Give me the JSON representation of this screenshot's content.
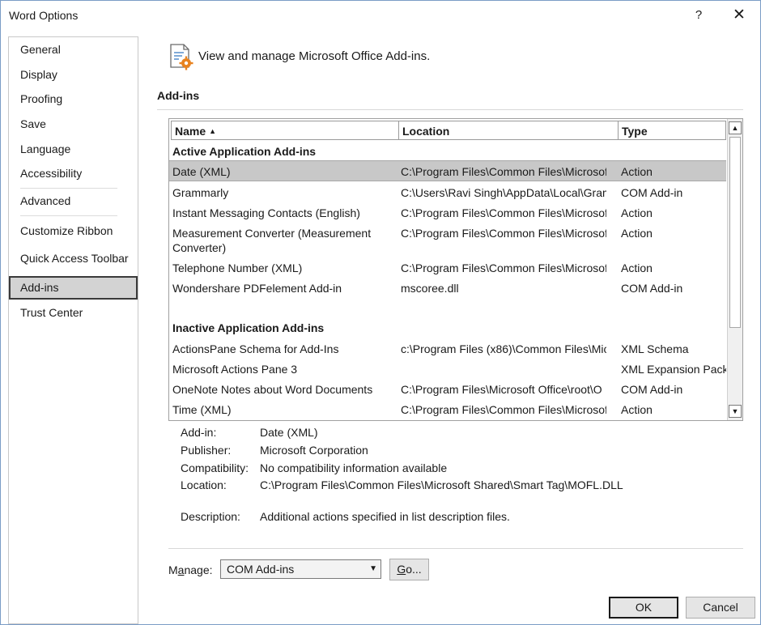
{
  "window": {
    "title": "Word Options",
    "help_label": "?",
    "close_label": "✕"
  },
  "sidebar": {
    "items": [
      {
        "label": "General"
      },
      {
        "label": "Display"
      },
      {
        "label": "Proofing"
      },
      {
        "label": "Save"
      },
      {
        "label": "Language"
      },
      {
        "label": "Accessibility"
      },
      {
        "label": "Advanced"
      },
      {
        "label": "Customize Ribbon"
      },
      {
        "label": "Quick Access Toolbar"
      },
      {
        "label": "Add-ins"
      },
      {
        "label": "Trust Center"
      }
    ],
    "selected": "Add-ins"
  },
  "header": {
    "icon": "addins-gear-icon",
    "text": "View and manage Microsoft Office Add-ins."
  },
  "section_title": "Add-ins",
  "table": {
    "columns": [
      {
        "label": "Name",
        "sort": "ascending"
      },
      {
        "label": "Location"
      },
      {
        "label": "Type"
      }
    ],
    "groups": [
      {
        "title": "Active Application Add-ins",
        "rows": [
          {
            "name": "Date (XML)",
            "location": "C:\\Program Files\\Common Files\\Microsof",
            "type": "Action",
            "selected": true
          },
          {
            "name": "Grammarly",
            "location": "C:\\Users\\Ravi Singh\\AppData\\Local\\Gram",
            "type": "COM Add-in"
          },
          {
            "name": "Instant Messaging Contacts (English)",
            "location": "C:\\Program Files\\Common Files\\Microsof",
            "type": "Action"
          },
          {
            "name": "Measurement Converter (Measurement Converter)",
            "location": "C:\\Program Files\\Common Files\\Microsof",
            "type": "Action"
          },
          {
            "name": "Telephone Number (XML)",
            "location": "C:\\Program Files\\Common Files\\Microsof",
            "type": "Action"
          },
          {
            "name": "Wondershare PDFelement Add-in",
            "location": "mscoree.dll",
            "type": "COM Add-in"
          }
        ]
      },
      {
        "title": "Inactive Application Add-ins",
        "rows": [
          {
            "name": "ActionsPane Schema for Add-Ins",
            "location": "c:\\Program Files (x86)\\Common Files\\Mic",
            "type": "XML Schema"
          },
          {
            "name": "Microsoft Actions Pane 3",
            "location": "",
            "type": "XML Expansion Pack"
          },
          {
            "name": "OneNote Notes about Word Documents",
            "location": "C:\\Program Files\\Microsoft Office\\root\\O",
            "type": "COM Add-in"
          },
          {
            "name": "Time (XML)",
            "location": "C:\\Program Files\\Common Files\\Microsof",
            "type": "Action"
          }
        ]
      }
    ]
  },
  "details": {
    "addin_label": "Add-in:",
    "addin_value": "Date (XML)",
    "publisher_label": "Publisher:",
    "publisher_value": "Microsoft Corporation",
    "compat_label": "Compatibility:",
    "compat_value": "No compatibility information available",
    "location_label": "Location:",
    "location_value": "C:\\Program Files\\Common Files\\Microsoft Shared\\Smart Tag\\MOFL.DLL",
    "description_label": "Description:",
    "description_value": "Additional actions specified in list description files."
  },
  "manage": {
    "label_pre": "M",
    "label_accel": "a",
    "label_post": "nage:",
    "selected": "COM Add-ins",
    "go_accel": "G",
    "go_post": "o..."
  },
  "buttons": {
    "ok": "OK",
    "cancel": "Cancel"
  }
}
